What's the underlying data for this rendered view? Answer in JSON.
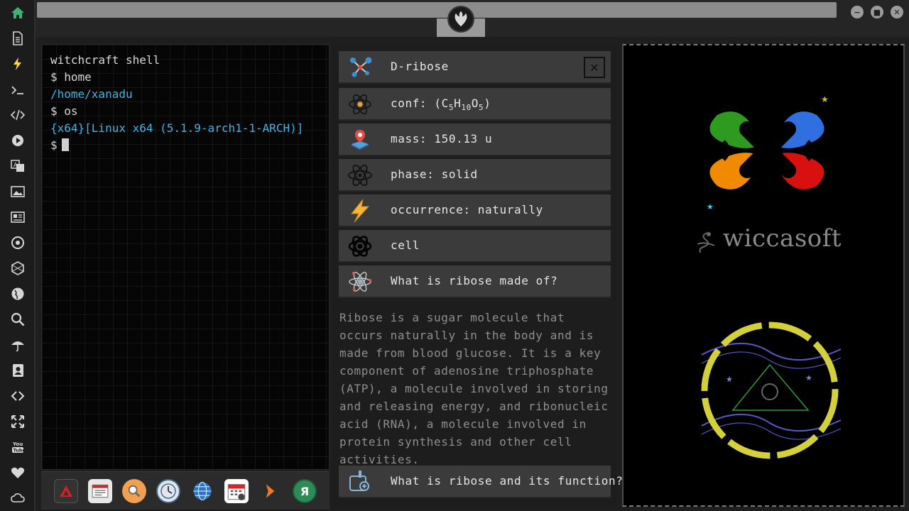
{
  "sidebar": {
    "icons": [
      "home-icon",
      "document-icon",
      "lightning-icon",
      "terminal-icon",
      "code-icon",
      "play-icon",
      "translate-icon",
      "image-icon",
      "news-icon",
      "settings-icon",
      "hexagon-icon",
      "globe-icon",
      "search-icon",
      "umbrella-icon",
      "contacts-icon",
      "share-icon",
      "fullscreen-icon",
      "youtube-icon",
      "heart-icon",
      "cloud-icon"
    ],
    "youtube_label": "You Tube",
    "accent_color": "#3cb371"
  },
  "window_controls": {
    "minimize": "−",
    "maximize": "■",
    "close": "✕"
  },
  "terminal": {
    "lines": [
      {
        "text": "witchcraft shell",
        "color": "white"
      },
      {
        "text": "$ home",
        "color": "white"
      },
      {
        "text": "/home/xanadu",
        "color": "blue"
      },
      {
        "text": "$ os",
        "color": "white"
      },
      {
        "text": "{x64}[Linux x64 (5.1.9-arch1-1-ARCH)]",
        "color": "blue"
      }
    ],
    "prompt": "$"
  },
  "dock": {
    "apps": [
      "launcher-icon",
      "news-app-icon",
      "search-app-icon",
      "clock-app-icon",
      "globe-app-icon",
      "calendar-app-icon",
      "forward-app-icon",
      "yandex-app-icon"
    ],
    "yandex_glyph": "Я"
  },
  "info": {
    "title": "D-ribose",
    "close_glyph": "✕",
    "formula_prefix": "conf: (C",
    "formula_c": "5",
    "formula_h_sym": "H",
    "formula_h": "10",
    "formula_o_sym": "O",
    "formula_o": "5",
    "formula_suffix": ")",
    "mass": "mass: 150.13 u",
    "phase": "phase: solid",
    "occurrence": "occurrence: naturally",
    "cell": "cell",
    "question1": "What is ribose made of?",
    "paragraph": "Ribose is a sugar molecule that occurs naturally in the body and is made from blood glucose. It is a key component of adenosine triphosphate (ATP), a molecule involved in storing and releasing energy, and ribonucleic acid (RNA), a molecule involved in protein synthesis and other cell activities.",
    "question2": "What is ribose and its function?"
  },
  "brand": {
    "name": "wiccasoft",
    "colors": {
      "green": "#2e9a1f",
      "blue": "#2f6fe0",
      "orange": "#f08a00",
      "red": "#d81010",
      "ring": "#d4d03a"
    }
  }
}
